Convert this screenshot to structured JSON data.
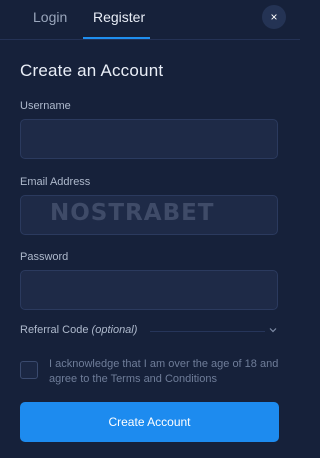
{
  "tabs": [
    {
      "label": "Login",
      "active": false
    },
    {
      "label": "Register",
      "active": true
    }
  ],
  "close_icon": "×",
  "form": {
    "title": "Create an Account",
    "username": {
      "label": "Username",
      "value": "",
      "placeholder": ""
    },
    "email": {
      "label": "Email Address",
      "value": "",
      "placeholder": ""
    },
    "password": {
      "label": "Password",
      "value": "",
      "placeholder": ""
    },
    "referral": {
      "label": "Referral Code",
      "optional_label": "(optional)",
      "icon": "chevron-down-icon"
    },
    "terms": {
      "checked": false,
      "text": "I acknowledge that I am over the age of 18 and agree to the Terms and Conditions"
    },
    "submit_label": "Create Account"
  },
  "watermark": {
    "text": "NOSTRABET"
  },
  "colors": {
    "background": "#16213a",
    "input_bg": "#1e2a47",
    "accent": "#1d8bef"
  }
}
